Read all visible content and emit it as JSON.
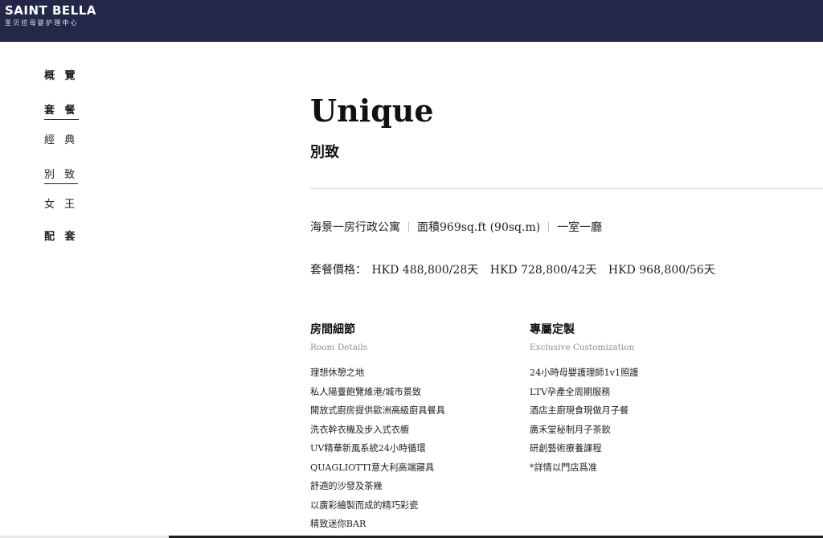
{
  "header": {
    "brand": "SAINT BELLA",
    "brand_sub": "圣贝拉母婴护理中心",
    "bg_color": "#242848"
  },
  "sidebar": {
    "items": [
      {
        "label": "概 覽",
        "bold": true,
        "active": false
      },
      {
        "label": "套 餐",
        "bold": true,
        "active": true
      },
      {
        "label": "經 典",
        "bold": false,
        "active": false
      },
      {
        "label": "別 致",
        "bold": false,
        "active": true
      },
      {
        "label": "女 王",
        "bold": false,
        "active": false
      },
      {
        "label": "配 套",
        "bold": true,
        "active": false
      }
    ]
  },
  "package": {
    "title_en": "Unique",
    "title_zh": "別致",
    "specs": [
      "海景一房行政公寓",
      "面積969sq.ft (90sq.m)",
      "一室一廳"
    ],
    "price_label": "套餐價格：",
    "prices": [
      "HKD 488,800/28天",
      "HKD 728,800/42天",
      "HKD 968,800/56天"
    ]
  },
  "room_details": {
    "title": "房間細節",
    "subtitle": "Room Details",
    "items": [
      "理想休憩之地",
      "私人陽臺飽覽維港/城市景致",
      "開放式廚房提供歐洲高級廚具餐具",
      "洗衣幹衣機及步入式衣櫥",
      "UV精華新風系統24小時循環",
      "QUAGLIOTTI意大利高端寢具",
      "舒適的沙發及茶幾",
      "以廣彩繪製而成的精巧彩瓷",
      "精致迷你BAR"
    ]
  },
  "customization": {
    "title": "專屬定製",
    "subtitle": "Exclusive Customization",
    "items": [
      "24小時母嬰護理師1v1照護",
      "LTV孕產全周期服務",
      "酒店主廚現食現做月子餐",
      "廣禾堂秘制月子茶飲",
      "研創藝術療養課程",
      "*詳情以門店爲准"
    ]
  }
}
